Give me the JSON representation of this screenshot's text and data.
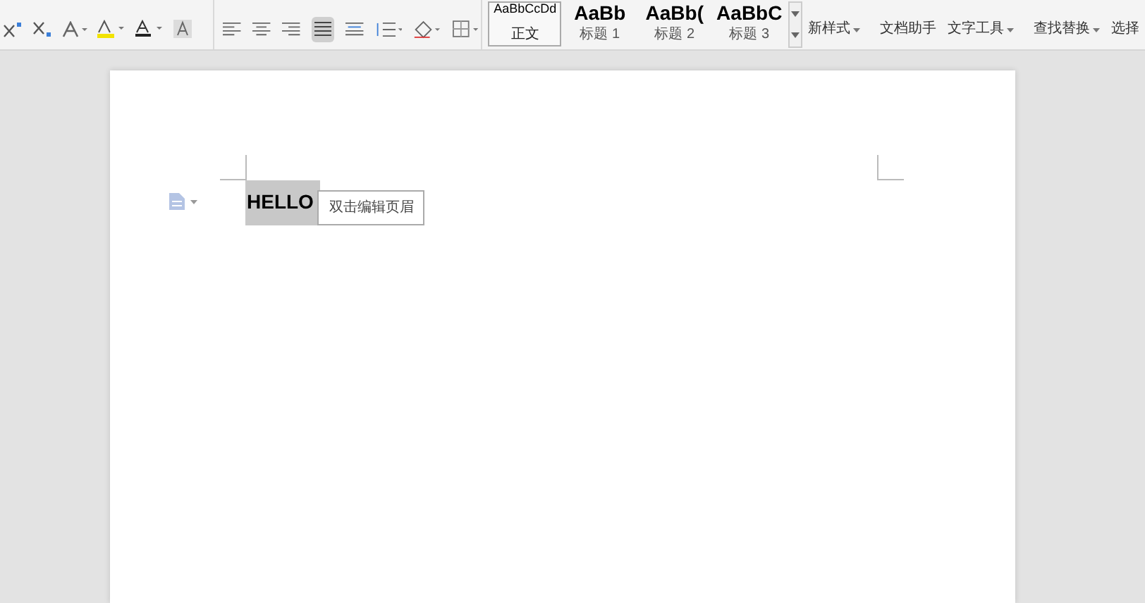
{
  "styles": [
    {
      "preview": "AaBbCcDd",
      "label": "正文",
      "selected": true
    },
    {
      "preview": "AaBb",
      "label": "标题 1",
      "selected": false
    },
    {
      "preview": "AaBb(",
      "label": "标题 2",
      "selected": false
    },
    {
      "preview": "AaBbC",
      "label": "标题 3",
      "selected": false
    }
  ],
  "tools": [
    {
      "label": "新样式",
      "dropdown": true
    },
    {
      "label": "文档助手",
      "dropdown": false
    },
    {
      "label": "文字工具",
      "dropdown": true
    },
    {
      "label": "查找替换",
      "dropdown": true
    },
    {
      "label": "选择",
      "dropdown": false
    }
  ],
  "document": {
    "header_text": "HELLO",
    "header_tooltip": "双击编辑页眉"
  }
}
